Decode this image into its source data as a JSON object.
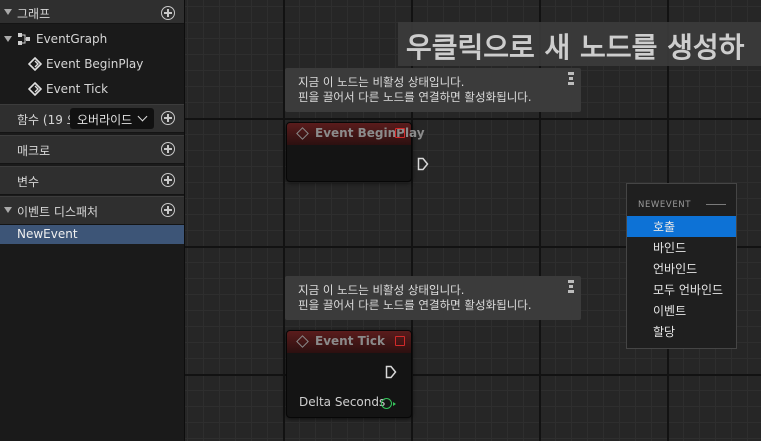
{
  "left_panel": {
    "graphs": {
      "label": "그래프"
    },
    "event_graph": {
      "label": "EventGraph"
    },
    "begin_play": {
      "label": "Event BeginPlay"
    },
    "tick": {
      "label": "Event Tick"
    },
    "functions": {
      "label": "함수 (19 오",
      "override_label": "오버라이드"
    },
    "macros": {
      "label": "매크로"
    },
    "variables": {
      "label": "변수"
    },
    "dispatchers": {
      "label": "이벤트 디스패처"
    },
    "new_event": {
      "label": "NewEvent"
    }
  },
  "graph": {
    "hint": "우클릭으로 새 노드를 생성하",
    "comment_1": {
      "line1": "지금 이 노드는 비활성 상태입니다.",
      "line2": "핀을 끌어서 다른 노드를 연결하면 활성화됩니다."
    },
    "comment_2": {
      "line1": "지금 이 노드는 비활성 상태입니다.",
      "line2": "핀을 끌어서 다른 노드를 연결하면 활성화됩니다."
    },
    "node_begin_play": {
      "title": "Event BeginPlay"
    },
    "node_tick": {
      "title": "Event Tick",
      "pin": "Delta Seconds"
    }
  },
  "context_menu": {
    "header": "NEWEVENT",
    "items": [
      "호출",
      "바인드",
      "언바인드",
      "모두 언바인드",
      "이벤트",
      "할당"
    ],
    "selected": "호출"
  },
  "colors": {
    "accent": "#0d72d6",
    "event_head": "#5a1c1c",
    "selection": "#3d5577",
    "float_pin": "#35c45b"
  }
}
